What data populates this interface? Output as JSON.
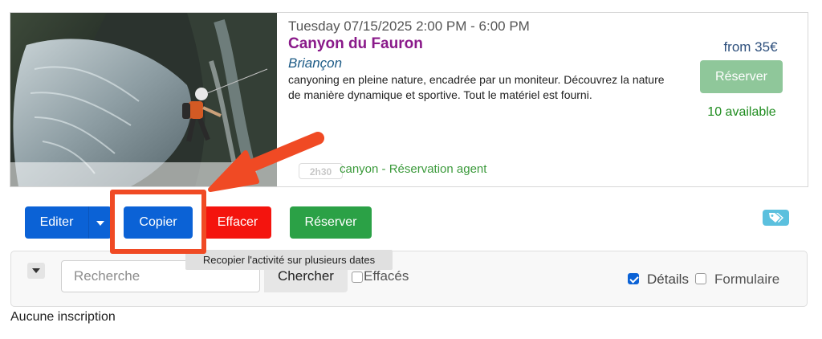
{
  "activity": {
    "date": "Tuesday 07/15/2025 2:00 PM - 6:00 PM",
    "title": "Canyon du Fauron",
    "location": "Briançon",
    "description": "canyoning en pleine nature, encadrée par un moniteur. Découvrez la nature de manière dynamique et sportive. Tout le matériel est fourni.",
    "duration": "2h30",
    "category": "canyon - Réservation agent",
    "price": "from 35€",
    "reserve_label": "Réserver",
    "availability": "10 available"
  },
  "actions": {
    "edit_label": "Editer",
    "copy_label": "Copier",
    "delete_label": "Effacer",
    "reserve_label": "Réserver",
    "tooltip": "Recopier l'activité sur plusieurs dates"
  },
  "search": {
    "placeholder": "Recherche",
    "button_label": "Chercher",
    "deleted_label": "Effacés",
    "details_label": "Détails",
    "details_checked": true,
    "form_label": "Formulaire",
    "form_checked": false
  },
  "registrations": {
    "empty_message": "Aucune inscription"
  },
  "colors": {
    "primary": "#0b62d6",
    "danger": "#f4140e",
    "success": "#2ba146",
    "title": "#8a1a8a",
    "annotation": "#f04a24",
    "info": "#5bc0de"
  }
}
